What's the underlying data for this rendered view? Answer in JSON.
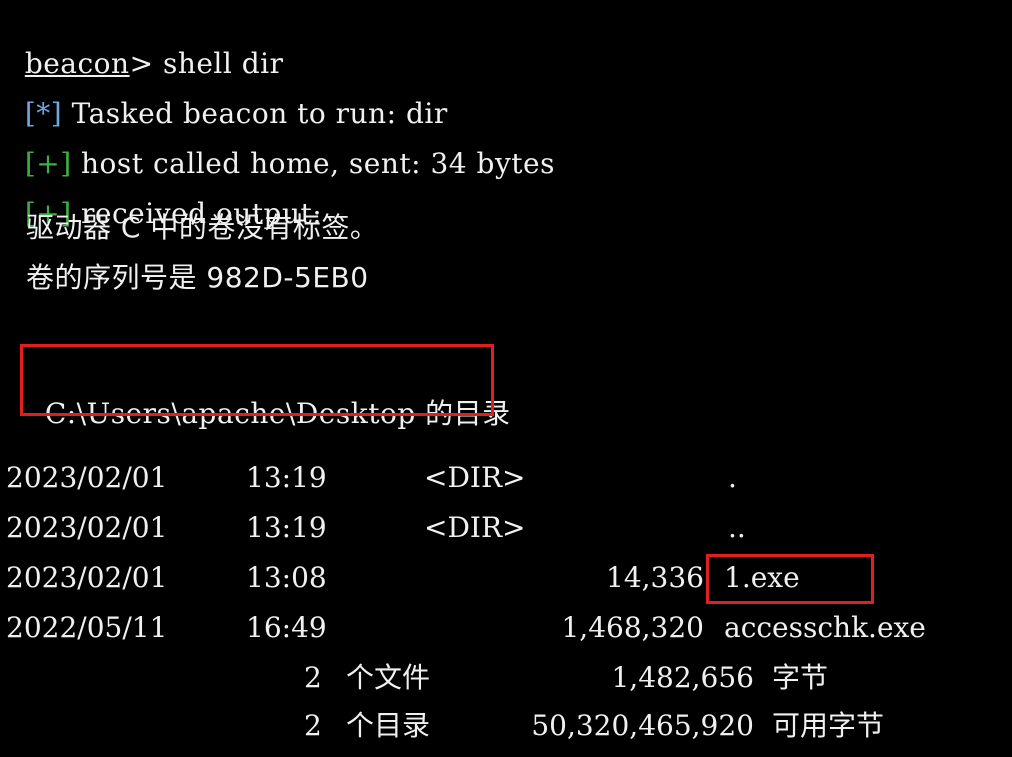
{
  "console": {
    "prompt": "beacon",
    "prompt_suffix": ">",
    "command": " shell dir",
    "lines": [
      {
        "tag": "[*]",
        "text": " Tasked beacon to run: dir"
      },
      {
        "tag": "[+]",
        "text": " host called home, sent: 34 bytes"
      },
      {
        "tag": "[+]",
        "text": " received output:"
      }
    ],
    "volume_label": "驱动器 C 中的卷没有标签。",
    "volume_serial": "卷的序列号是 982D-5EB0",
    "dir_path": "C:\\Users\\apache\\Desktop",
    "dir_suffix": " 的目录",
    "entries": [
      {
        "date": "2023/02/01",
        "time": "13:19",
        "type": "<DIR>",
        "size": "",
        "name": "."
      },
      {
        "date": "2023/02/01",
        "time": "13:19",
        "type": "<DIR>",
        "size": "",
        "name": ".."
      },
      {
        "date": "2023/02/01",
        "time": "13:08",
        "type": "",
        "size": "14,336",
        "name": "1.exe"
      },
      {
        "date": "2022/05/11",
        "time": "16:49",
        "type": "",
        "size": "1,468,320",
        "name": "accesschk.exe"
      }
    ],
    "summary_files": {
      "count": "2",
      "label": "个文件",
      "bytes": "1,482,656",
      "unit": "字节"
    },
    "summary_dirs": {
      "count": "2",
      "label": "个目录",
      "bytes": "50,320,465,920",
      "unit": "可用字节"
    }
  },
  "colors": {
    "background": "#000000",
    "text": "#f0f0f0",
    "info_tag": "#6fa8dc",
    "ok_tag": "#3cb043",
    "highlight_box": "#e02020"
  }
}
